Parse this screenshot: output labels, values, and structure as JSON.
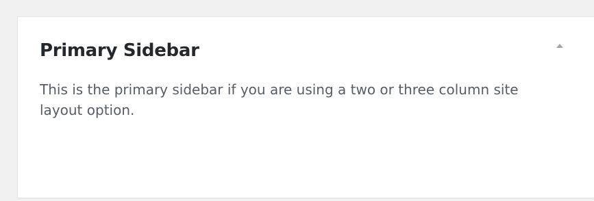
{
  "widget_area": {
    "title": "Primary Sidebar",
    "description": "This is the primary sidebar if you are using a two or three column site layout option.",
    "toggle_icon": "arrow-up-icon"
  },
  "colors": {
    "background": "#f1f1f1",
    "panel": "#ffffff",
    "title": "#23282d",
    "description": "#555d66",
    "arrow": "#a0a5aa"
  }
}
